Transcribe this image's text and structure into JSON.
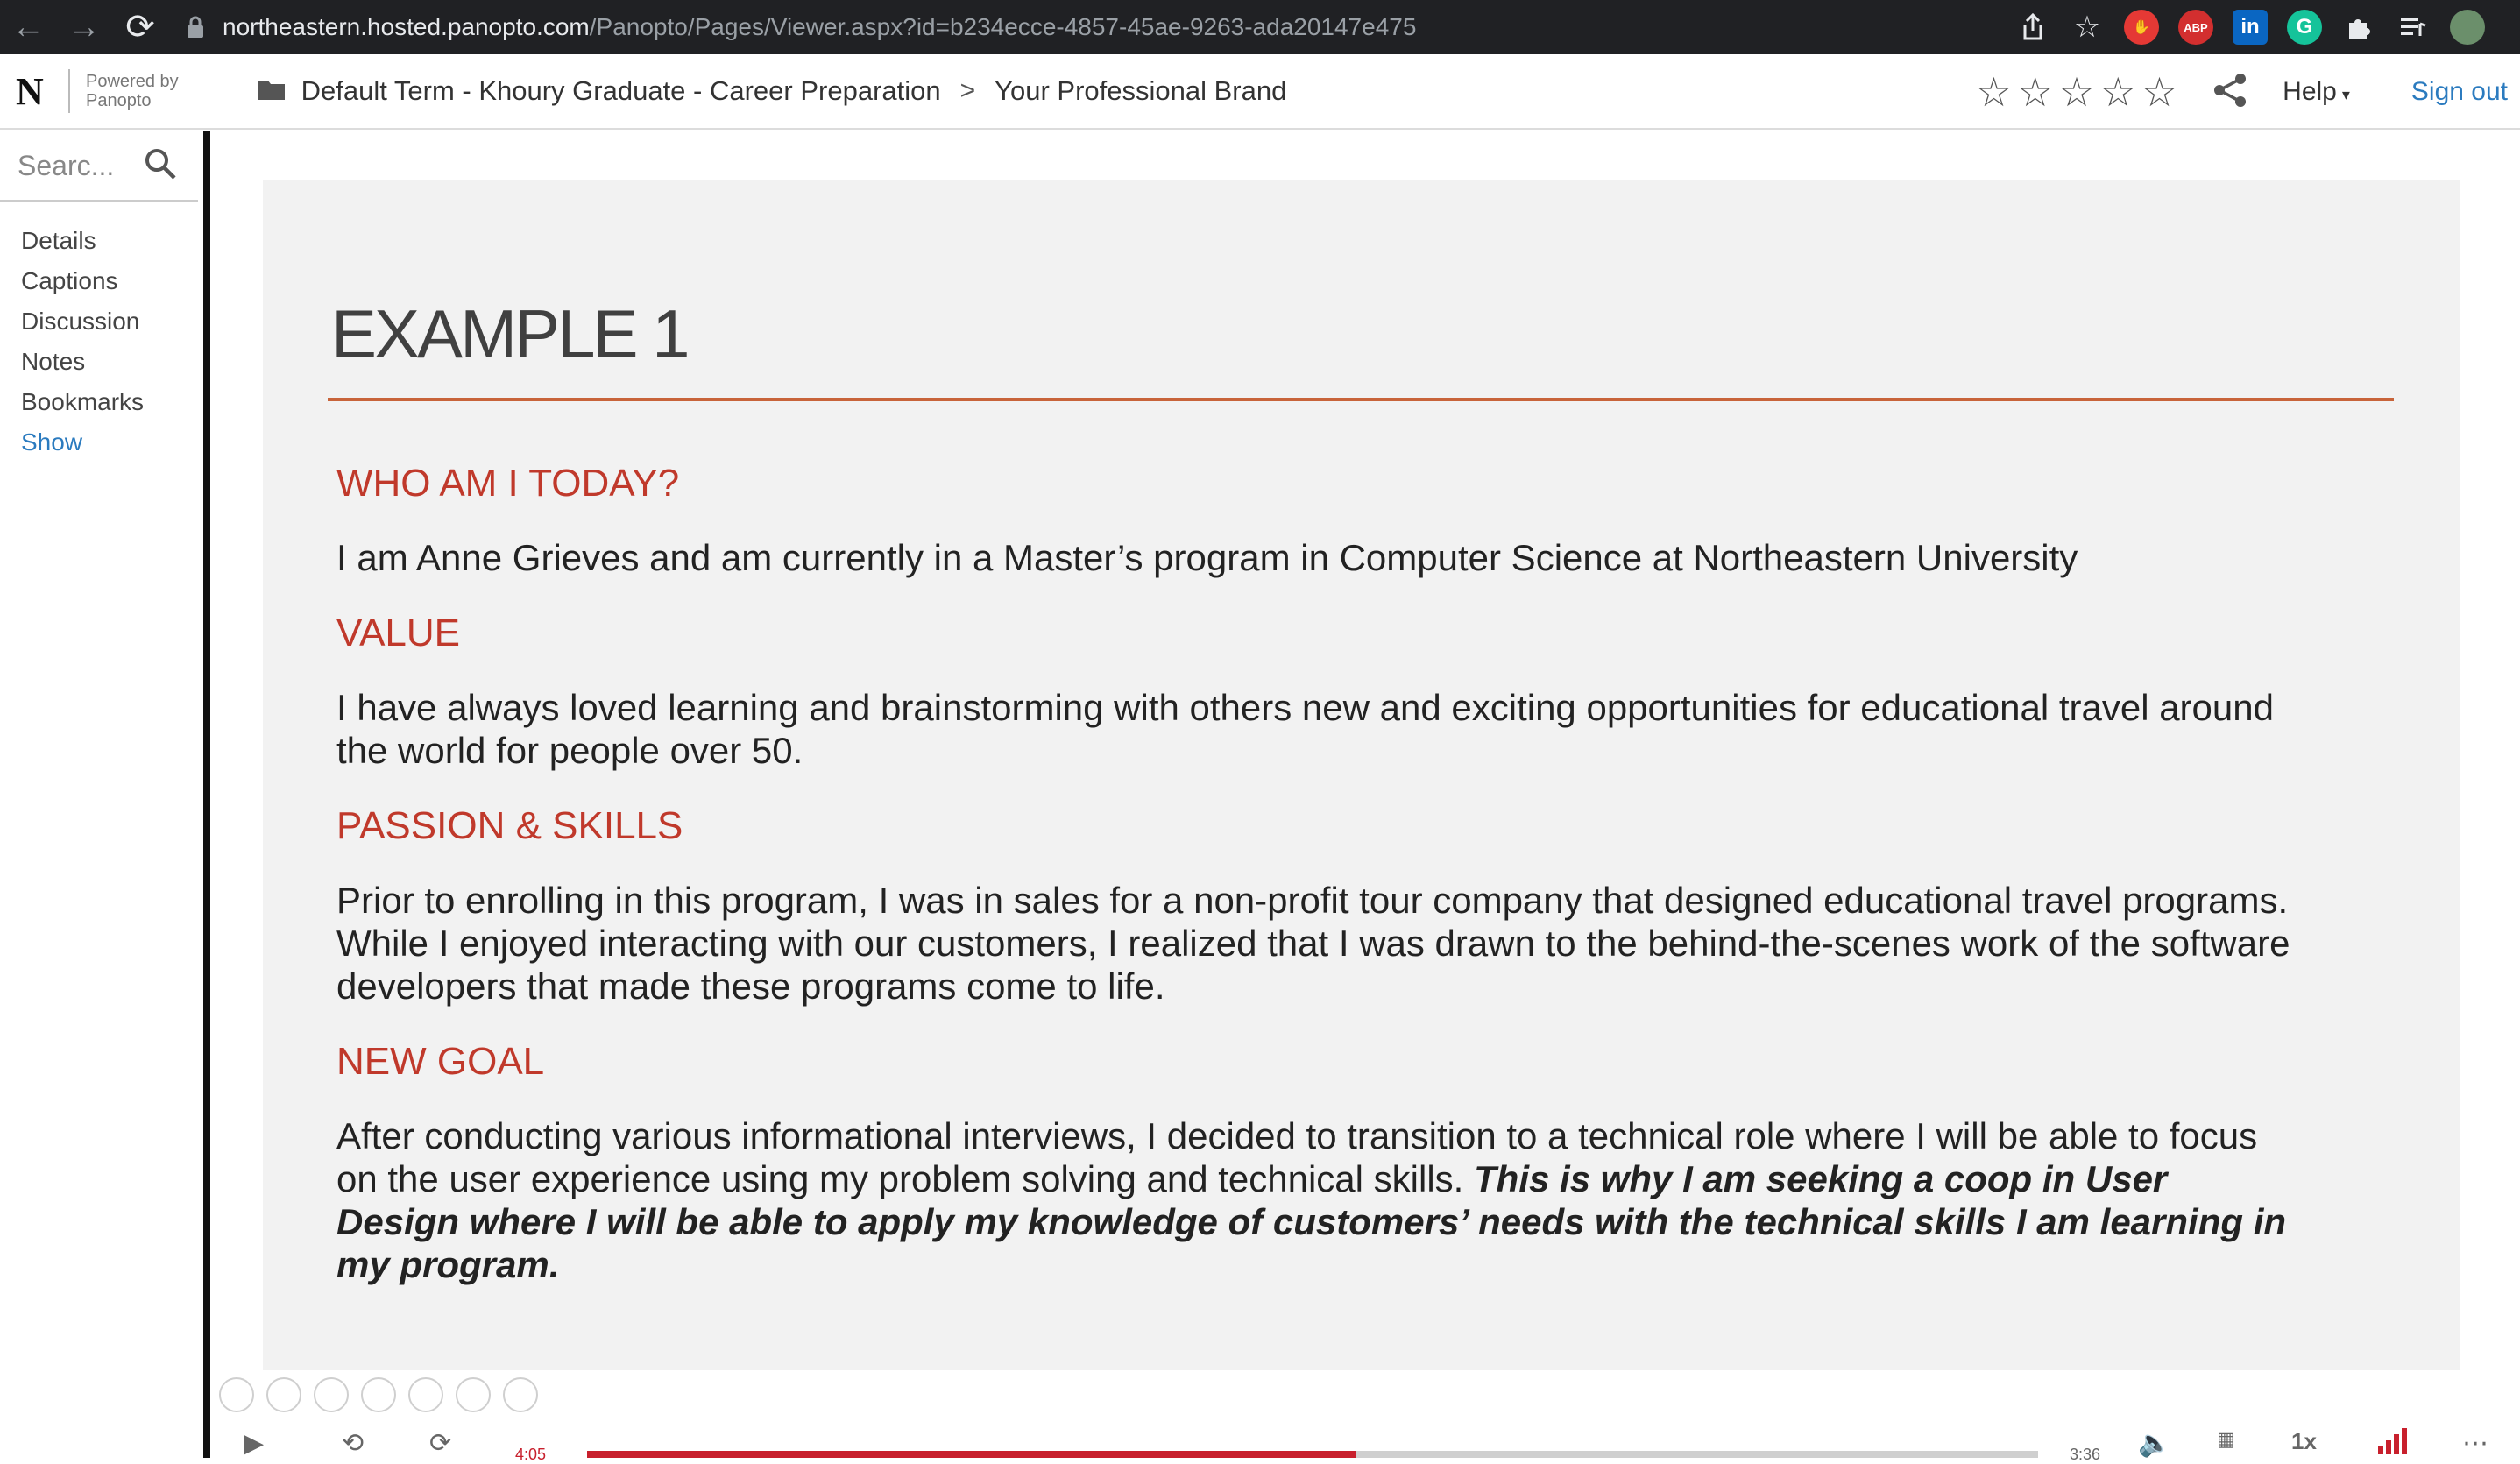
{
  "browser": {
    "url_host": "northeastern.hosted.panopto.com",
    "url_path": "/Panopto/Pages/Viewer.aspx?id=b234ecce-4857-45ae-9263-ada20147e475",
    "extensions": [
      "share-icon",
      "bookmark-star-icon",
      "red-extension-icon",
      "adblock-icon",
      "linkedin-icon",
      "grammarly-icon",
      "puzzle-extensions-icon",
      "reading-list-icon",
      "profile-avatar"
    ],
    "abp_label": "ABP",
    "linkedin_label": "in",
    "grammarly_label": "G"
  },
  "header": {
    "logo": "N",
    "powered_line1": "Powered by",
    "powered_line2": "Panopto",
    "breadcrumb_folder": "Default Term - Khoury Graduate - Career Preparation",
    "breadcrumb_separator": ">",
    "breadcrumb_current": "Your Professional Brand",
    "rating_stars": 5,
    "help_label": "Help",
    "signout_label": "Sign out"
  },
  "sidebar": {
    "search_placeholder": "Searc...",
    "items": [
      {
        "label": "Details"
      },
      {
        "label": "Captions"
      },
      {
        "label": "Discussion"
      },
      {
        "label": "Notes"
      },
      {
        "label": "Bookmarks"
      }
    ],
    "show_label": "Show"
  },
  "slide": {
    "title": "EXAMPLE 1",
    "sections": [
      {
        "heading": "WHO AM I TODAY?",
        "text": "I am Anne Grieves and am currently in a Master’s program in Computer Science at Northeastern University"
      },
      {
        "heading": "VALUE",
        "text": "I have always loved learning and brainstorming with others new and exciting opportunities for educational travel around the world for people over 50."
      },
      {
        "heading": "PASSION & SKILLS",
        "text": "Prior to enrolling in this program, I was in sales for a non-profit tour company that designed educational travel programs. While I enjoyed interacting with our customers, I realized that I was drawn to the behind-the-scenes work of the software developers that made these programs come to life."
      },
      {
        "heading": "NEW GOAL",
        "text": "After conducting various informational interviews, I decided to transition to a technical role where I will be able to focus on the user experience using my problem solving and technical skills.",
        "emphasis": " This is why I am seeking a coop in User Design where I will be able to apply my knowledge of customers’ needs with the technical skills I am learning in my program."
      }
    ]
  },
  "player": {
    "elapsed": "4:05",
    "remaining": "3:36",
    "progress_fraction": 0.53,
    "speed": "1x",
    "colors": {
      "progress": "#c8202d",
      "accent": "#2b7bbf",
      "heading": "#c0392b",
      "rule": "#c8643a"
    }
  }
}
